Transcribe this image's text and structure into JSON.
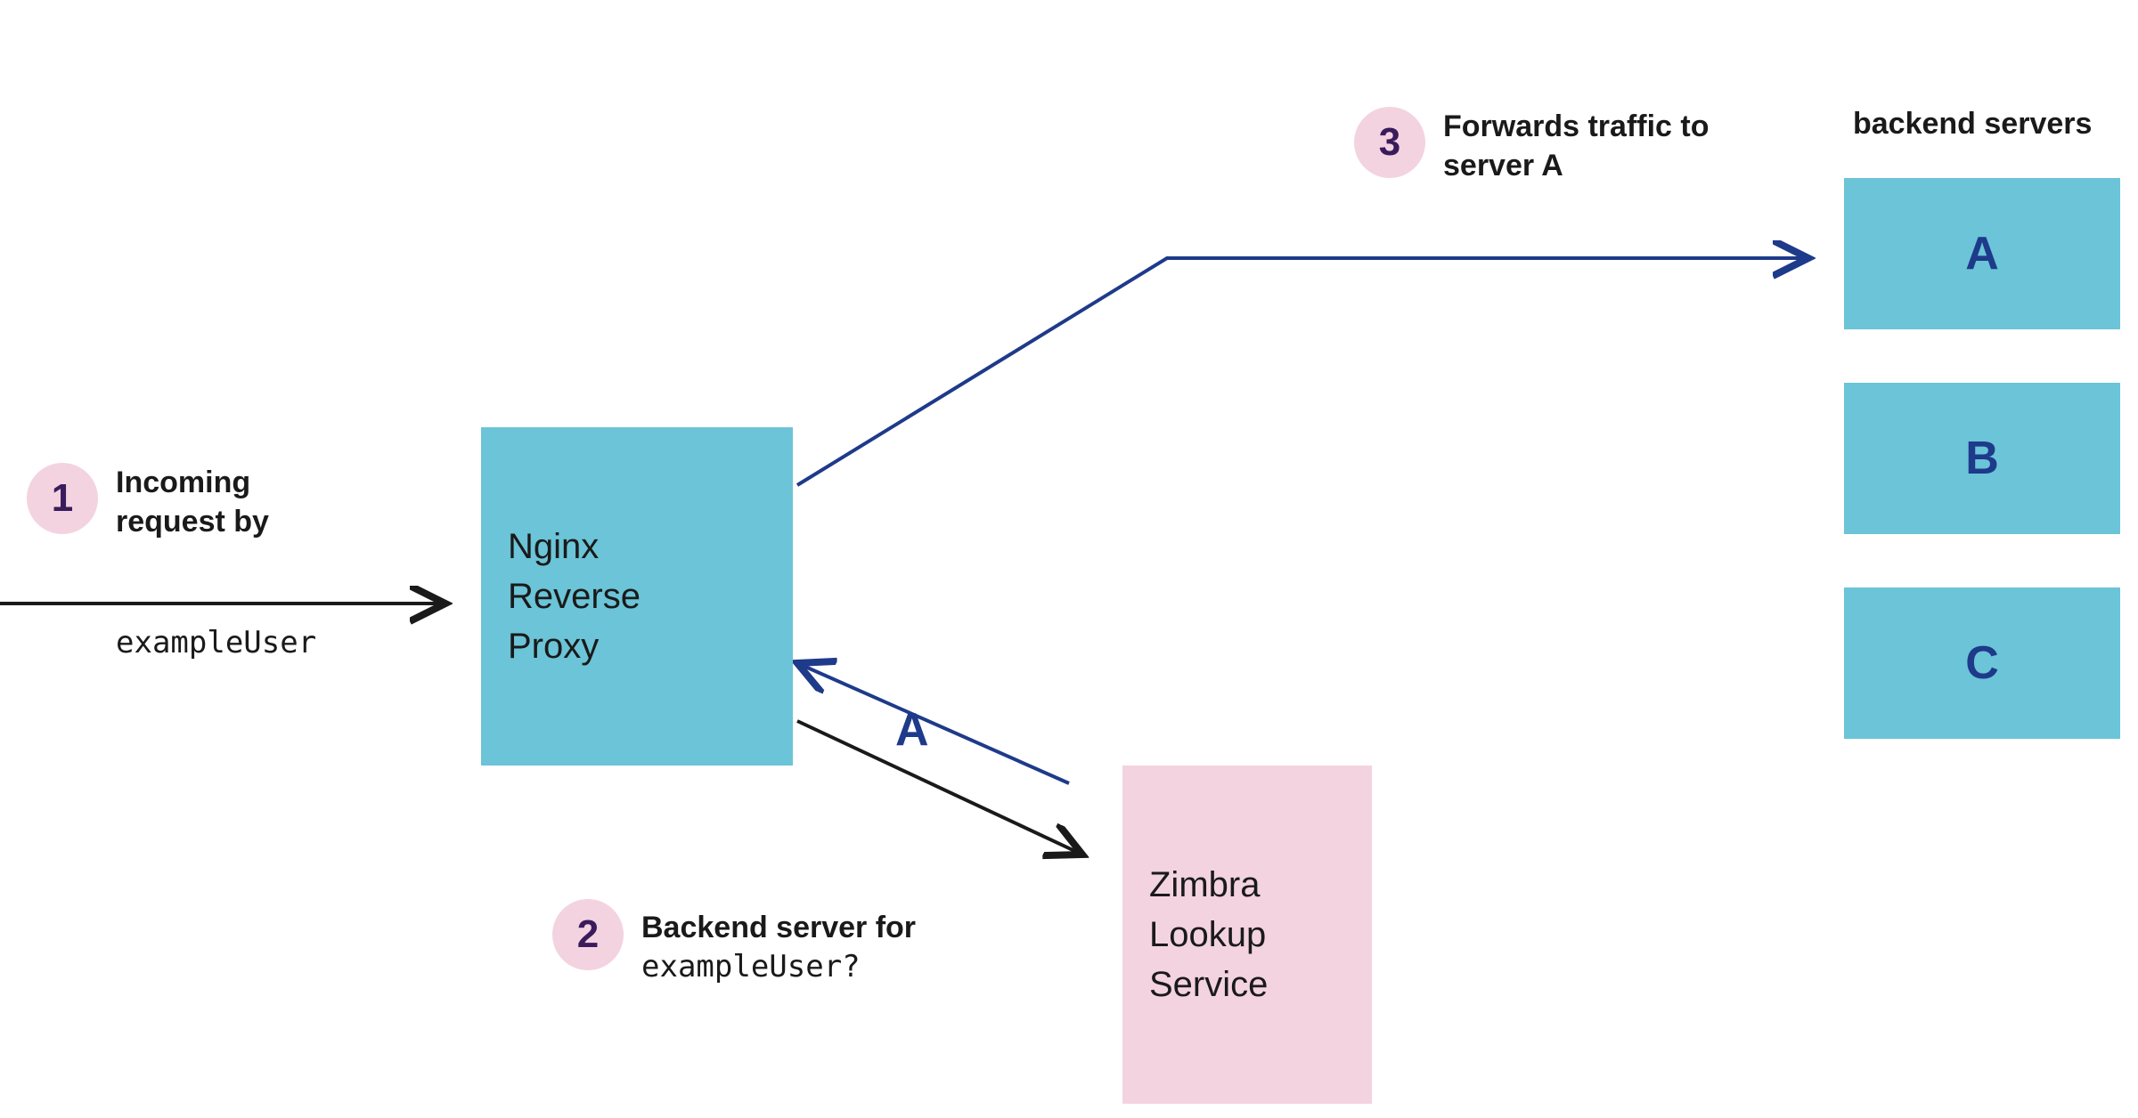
{
  "steps": {
    "s1": {
      "num": "1",
      "label_line1": "Incoming",
      "label_line2": "request by",
      "user": "exampleUser"
    },
    "s2": {
      "num": "2",
      "label": "Backend server for",
      "user": "exampleUser?"
    },
    "s3": {
      "num": "3",
      "label_line1": "Forwards traffic to",
      "label_line2": "server A"
    }
  },
  "nodes": {
    "proxy": "Nginx\nReverse\nProxy",
    "lookup": "Zimbra\nLookup\nService"
  },
  "backend": {
    "title": "backend servers",
    "servers": [
      "A",
      "B",
      "C"
    ]
  },
  "reply": "A",
  "colors": {
    "badge_bg": "#f3d3e0",
    "badge_fg": "#3a1b5c",
    "blue_box": "#6bc4d7",
    "pink_box": "#f3d3e0",
    "dark_text": "#1a1a1a",
    "navy": "#1e3a8a",
    "arrow_black": "#1a1a1a",
    "arrow_navy": "#1e3a8a"
  }
}
